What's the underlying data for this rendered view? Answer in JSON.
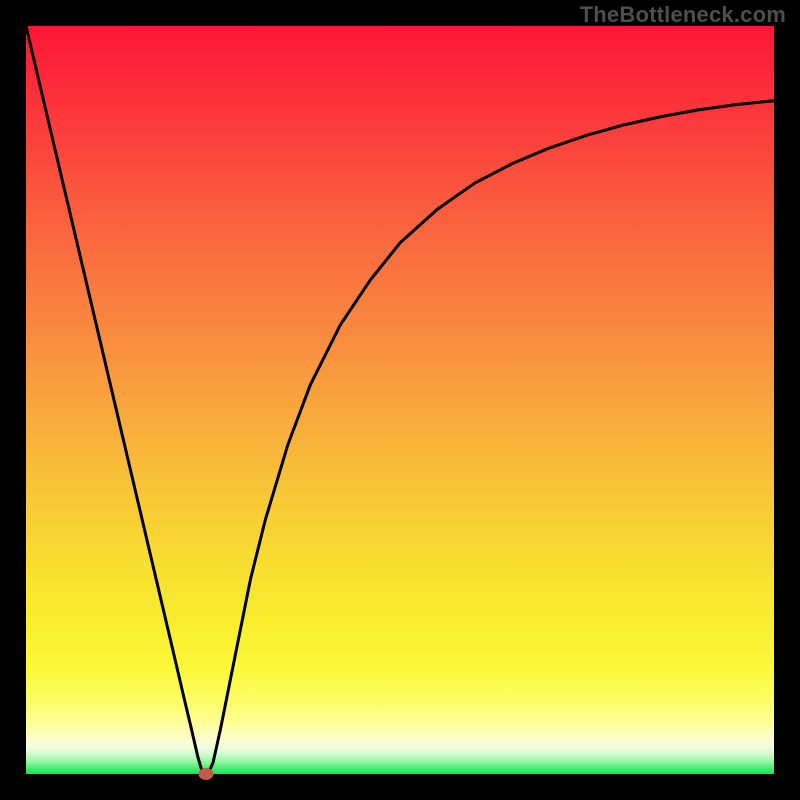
{
  "watermark": "TheBottleneck.com",
  "colors": {
    "frame_border": "#000000",
    "curve": "#000000",
    "marker": "#c05a4a"
  },
  "chart_data": {
    "type": "line",
    "title": "",
    "xlabel": "",
    "ylabel": "",
    "xlim": [
      0,
      100
    ],
    "ylim": [
      0,
      100
    ],
    "grid": false,
    "legend": false,
    "series": [
      {
        "name": "curve",
        "x": [
          0,
          2,
          4,
          6,
          8,
          10,
          12,
          14,
          16,
          18,
          20,
          21,
          22,
          23,
          23.5,
          24,
          24.5,
          25,
          26,
          27,
          28,
          30,
          32,
          35,
          38,
          42,
          46,
          50,
          55,
          60,
          65,
          70,
          75,
          80,
          85,
          90,
          95,
          100
        ],
        "y": [
          100,
          91.5,
          83.0,
          74.5,
          66.0,
          57.5,
          49.0,
          40.5,
          32.0,
          23.5,
          15.0,
          10.7,
          6.5,
          2.2,
          0.5,
          0.0,
          0.4,
          1.5,
          6.0,
          11.0,
          16.0,
          26.0,
          34.0,
          44.0,
          52.0,
          60.0,
          66.0,
          71.0,
          75.5,
          79.0,
          81.6,
          83.7,
          85.4,
          86.8,
          87.9,
          88.8,
          89.5,
          90.0
        ]
      }
    ],
    "marker": {
      "x": 24,
      "y": 0
    }
  }
}
